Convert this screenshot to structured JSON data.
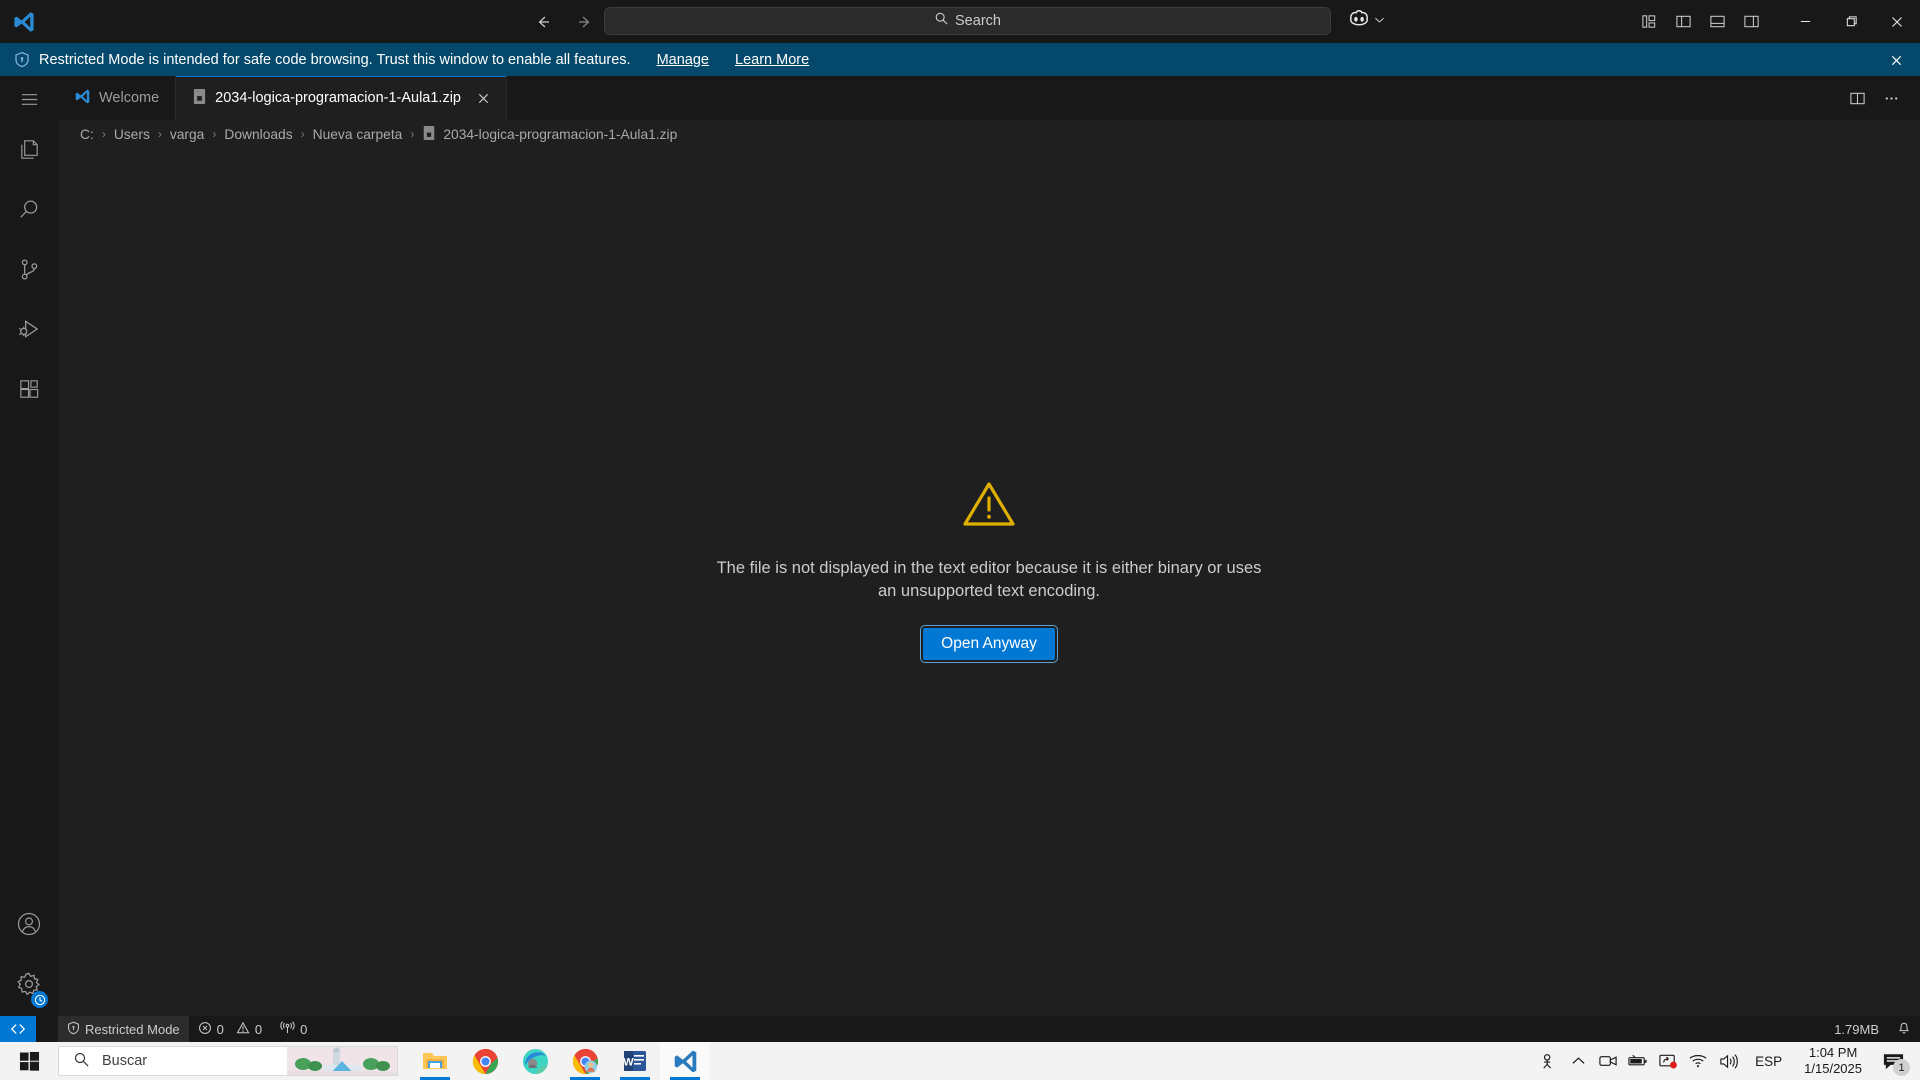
{
  "titlebar": {
    "back_icon": "arrow-left-icon",
    "forward_icon": "arrow-right-icon",
    "search_placeholder": "Search",
    "search_value": "",
    "copilot_icon": "copilot-icon",
    "layout_icons": [
      "customize-layout-icon",
      "toggle-primary-sidebar-icon",
      "toggle-panel-icon",
      "toggle-secondary-sidebar-icon"
    ],
    "minimize_label": "Minimize",
    "maximize_label": "Maximize",
    "close_label": "Close"
  },
  "banner": {
    "icon": "shield-icon",
    "message": "Restricted Mode is intended for safe code browsing. Trust this window to enable all features.",
    "manage_label": "Manage",
    "learn_more_label": "Learn More",
    "close_icon": "close-icon",
    "background": "#04486b"
  },
  "activitybar": {
    "menu_icon": "hamburger-menu-icon",
    "items": [
      {
        "name": "explorer",
        "icon": "files-icon"
      },
      {
        "name": "search",
        "icon": "search-icon"
      },
      {
        "name": "source-control",
        "icon": "source-control-icon"
      },
      {
        "name": "run-and-debug",
        "icon": "run-debug-icon"
      },
      {
        "name": "extensions",
        "icon": "extensions-icon"
      }
    ],
    "bottom_items": [
      {
        "name": "accounts",
        "icon": "account-icon"
      },
      {
        "name": "manage-settings",
        "icon": "gear-icon",
        "badge_icon": "clock-icon"
      }
    ]
  },
  "tabs": [
    {
      "label": "Welcome",
      "icon": "vscode-icon",
      "active": false,
      "closable": false
    },
    {
      "label": "2034-logica-programacion-1-Aula1.zip",
      "icon": "binary-file-icon",
      "active": true,
      "closable": true
    }
  ],
  "tabbar_actions": {
    "split_editor_icon": "split-editor-icon",
    "more_actions_icon": "more-actions-icon"
  },
  "breadcrumb": {
    "segments": [
      "C:",
      "Users",
      "varga",
      "Downloads",
      "Nueva carpeta"
    ],
    "file_label": "2034-logica-programacion-1-Aula1.zip",
    "file_icon": "binary-file-icon",
    "separator": "›"
  },
  "editor": {
    "warning_icon": "warning-triangle-icon",
    "warning_color": "#e0b000",
    "message": "The file is not displayed in the text editor because it is either binary or uses an unsupported text encoding.",
    "open_anyway_label": "Open Anyway",
    "button_color": "#0078d4"
  },
  "statusbar": {
    "remote_icon": "remote-window-icon",
    "trust_icon": "shield-icon",
    "trust_label": "Restricted Mode",
    "errors_icon": "error-icon",
    "errors_count": "0",
    "warnings_icon": "warning-icon",
    "warnings_count": "0",
    "ports_icon": "radio-tower-icon",
    "ports_count": "0",
    "file_size": "1.79MB",
    "bell_icon": "bell-icon"
  },
  "taskbar": {
    "start_icon": "windows-start-icon",
    "search_placeholder": "Buscar",
    "search_icon": "search-icon",
    "apps": [
      {
        "name": "file-explorer",
        "running": true,
        "active": false
      },
      {
        "name": "google-chrome",
        "running": false,
        "active": false
      },
      {
        "name": "microsoft-edge",
        "running": false,
        "active": false
      },
      {
        "name": "google-chrome-profile",
        "running": true,
        "active": false
      },
      {
        "name": "microsoft-word",
        "running": true,
        "active": false
      },
      {
        "name": "visual-studio-code",
        "running": true,
        "active": true
      }
    ],
    "tray": {
      "people_icon": "people-icon",
      "show_hidden_icon": "chevron-up-icon",
      "camera_icon": "camera-icon",
      "battery_icon": "battery-icon",
      "screen_share_icon": "screen-share-icon",
      "wifi_icon": "wifi-icon",
      "volume_icon": "volume-icon",
      "language": "ESP",
      "time": "1:04 PM",
      "date": "1/15/2025",
      "notifications_icon": "notifications-icon",
      "notifications_count": "1"
    }
  }
}
